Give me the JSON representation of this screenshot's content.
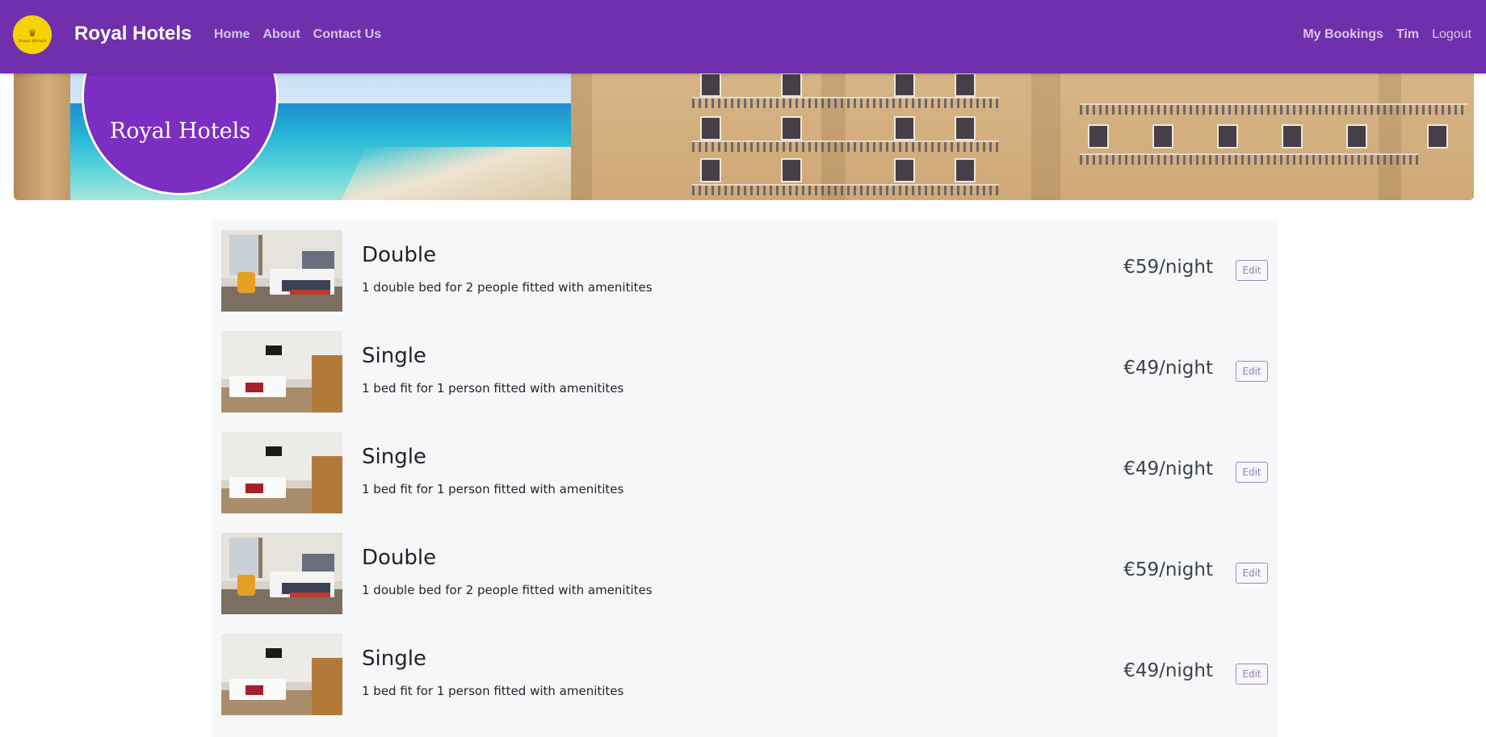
{
  "navbar": {
    "logo_text": "Royal Hotels",
    "brand": "Royal Hotels",
    "links": [
      "Home",
      "About",
      "Contact Us"
    ],
    "right_links": [
      "My Bookings",
      "Tim",
      "Logout"
    ],
    "color": "#7030ad"
  },
  "hero": {
    "badge_text": "Royal Hotels"
  },
  "rooms": [
    {
      "title": "Double",
      "description": "1 double bed for 2 people fitted with amenitites",
      "price": "€59/night",
      "action": "Edit"
    },
    {
      "title": "Single",
      "description": "1 bed fit for 1 person fitted with amenitites",
      "price": "€49/night",
      "action": "Edit"
    },
    {
      "title": "Single",
      "description": "1 bed fit for 1 person fitted with amenitites",
      "price": "€49/night",
      "action": "Edit"
    },
    {
      "title": "Double",
      "description": "1 double bed for 2 people fitted with amenitites",
      "price": "€59/night",
      "action": "Edit"
    },
    {
      "title": "Single",
      "description": "1 bed fit for 1 person fitted with amenitites",
      "price": "€49/night",
      "action": "Edit"
    }
  ],
  "icons": {
    "logo": "crown-logo-icon"
  }
}
